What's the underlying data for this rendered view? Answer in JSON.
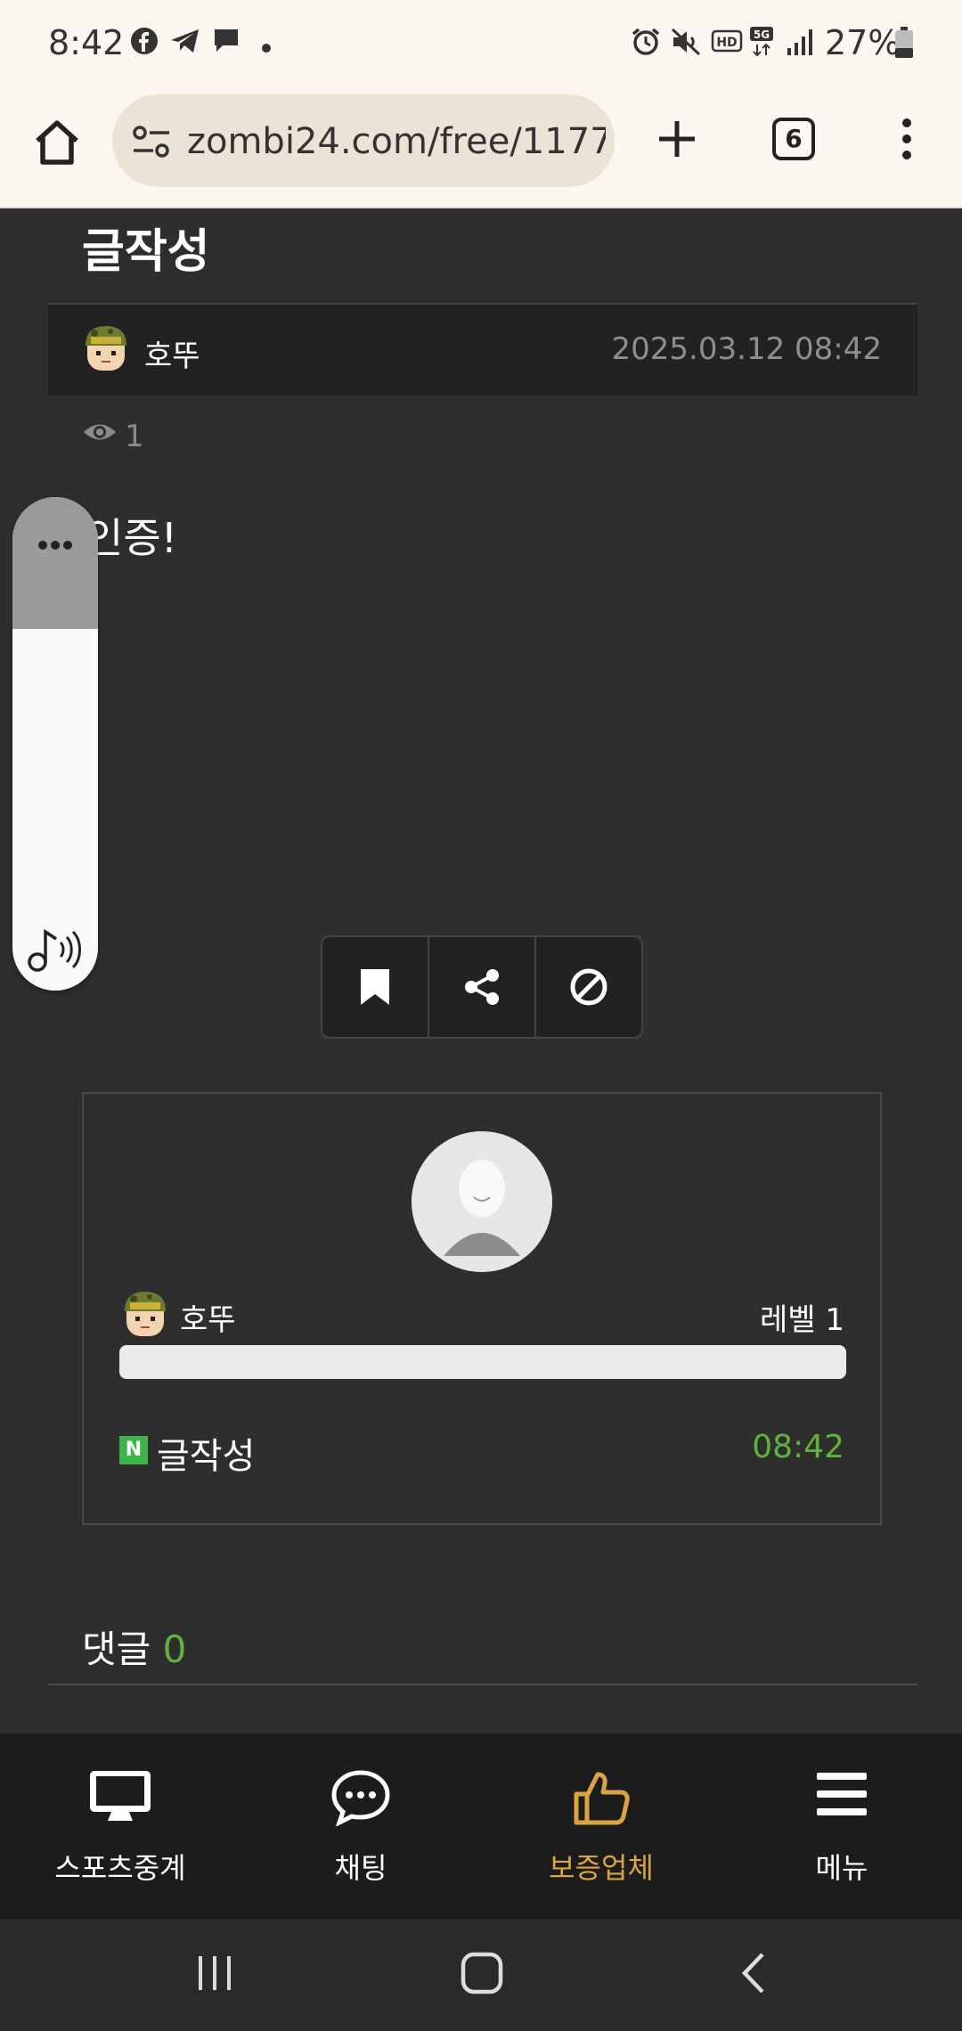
{
  "status_bar": {
    "time": "8:42",
    "battery_percent": "27%",
    "icons": [
      "facebook-icon",
      "telegram-icon",
      "chat-icon",
      "dot-icon",
      "alarm-icon",
      "mute-icon",
      "hd-icon",
      "5g-icon",
      "signal-icon",
      "battery-icon"
    ]
  },
  "browser": {
    "url": "zombi24.com/free/1177",
    "tab_count": "6"
  },
  "post": {
    "title": "글작성",
    "author": "호뚜",
    "date": "2025.03.12 08:42",
    "views": "1",
    "body": "인증!"
  },
  "profile_card": {
    "name": "호뚜",
    "level": "레벨 1",
    "level_progress": 0.0,
    "recent_post_title": "글작성",
    "recent_post_time": "08:42"
  },
  "comments": {
    "label": "댓글",
    "count": "0"
  },
  "bottom_nav": [
    {
      "label": "스포츠중계",
      "icon": "monitor-icon"
    },
    {
      "label": "채팅",
      "icon": "chat-bubble-icon"
    },
    {
      "label": "보증업체",
      "icon": "thumbs-up-icon",
      "active": true
    },
    {
      "label": "메뉴",
      "icon": "hamburger-menu-icon"
    }
  ],
  "colors": {
    "accent_green": "#5fb33a",
    "active_nav": "#d9a441",
    "background": "#2e2e2e"
  }
}
